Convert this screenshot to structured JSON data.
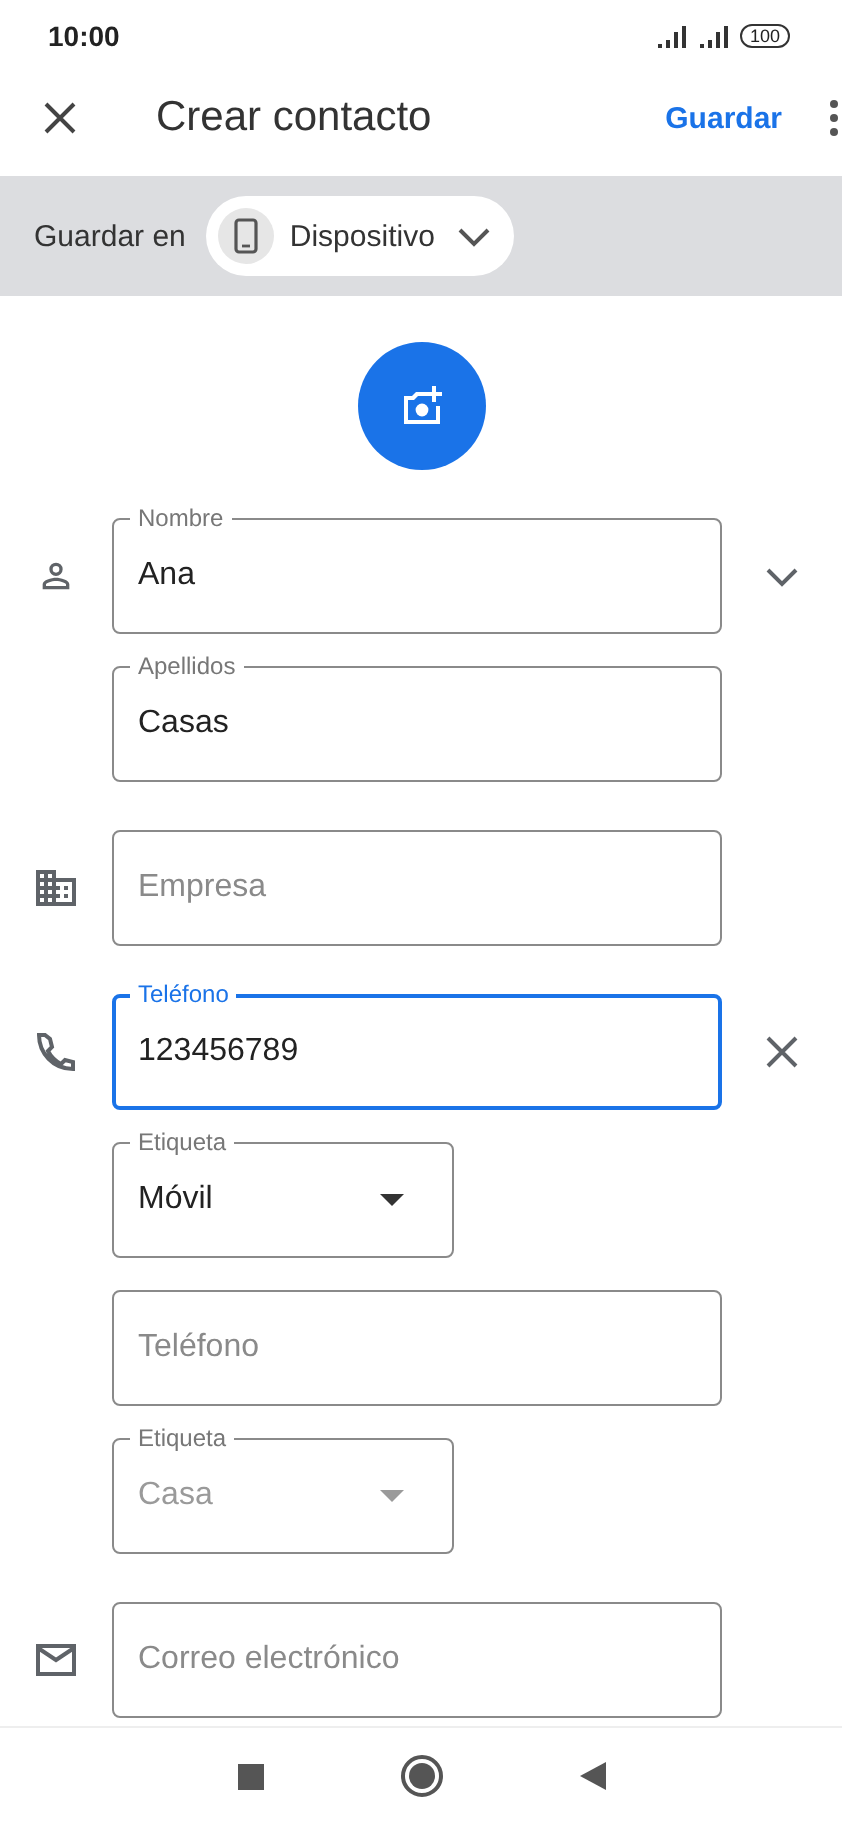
{
  "status_bar": {
    "time": "10:00",
    "battery": "100"
  },
  "app_bar": {
    "title": "Crear contacto",
    "save": "Guardar"
  },
  "save_in": {
    "label": "Guardar en",
    "account": "Dispositivo"
  },
  "fields": [
    {
      "kind": "name",
      "label": "Nombre",
      "value": "Ana",
      "focused": false
    },
    {
      "kind": "name",
      "label": "Apellidos",
      "value": "Casas",
      "focused": false
    },
    {
      "kind": "company",
      "placeholder": "Empresa",
      "focused": false
    },
    {
      "kind": "phone",
      "label": "Teléfono",
      "value": "123456789",
      "focused": true
    },
    {
      "kind": "dropdown",
      "label": "Etiqueta",
      "value": "Móvil",
      "disabled": false
    },
    {
      "kind": "phone",
      "placeholder": "Teléfono",
      "focused": false
    },
    {
      "kind": "dropdown",
      "label": "Etiqueta",
      "value": "Casa",
      "disabled": true
    },
    {
      "kind": "email",
      "placeholder": "Correo electrónico",
      "focused": false
    }
  ]
}
